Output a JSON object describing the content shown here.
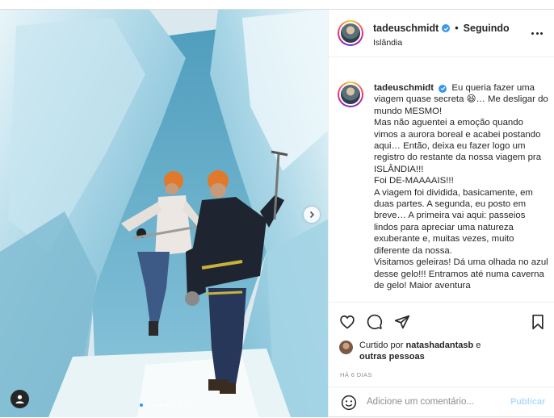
{
  "post": {
    "photo": {
      "alt_icon": "user-tag-icon",
      "next_icon": "chevron-right-icon",
      "carousel_total": 8,
      "carousel_active": 1
    },
    "header": {
      "username": "tadeuschmidt",
      "separator": "•",
      "follow_status": "Seguindo",
      "location": "Islândia",
      "more_icon": "more-options-icon"
    },
    "caption": {
      "username": "tadeuschmidt",
      "lines": [
        "Eu queria fazer uma viagem quase secreta 😆… Me desligar do mundo MESMO!",
        "Mas não aguentei a emoção quando vimos a aurora boreal e acabei postando aqui… Então, deixa eu fazer logo um registro do restante da nossa viagem pra ISLÂNDIA!!!",
        "Foi DE-MAAAAIS!!!",
        "A viagem foi dividida, basicamente, em duas partes. A segunda, eu posto em breve… A primeira vai aqui: passeios lindos para apreciar uma natureza exuberante e, muitas vezes, muito diferente da nossa.",
        "Visitamos geleiras! Dá uma olhada no azul desse gelo!!! Entramos até numa caverna de gelo! Maior aventura"
      ]
    },
    "actions": {
      "like_icon": "heart-icon",
      "comment_icon": "comment-icon",
      "share_icon": "share-icon",
      "save_icon": "bookmark-icon"
    },
    "likes": {
      "prefix": "Curtido por",
      "user": "natashadantasb",
      "conj": "e",
      "others": "outras pessoas"
    },
    "time_ago": "HÁ 6 DIAS",
    "comment": {
      "emoji_icon": "emoji-icon",
      "placeholder": "Adicione um comentário...",
      "publish_label": "Publicar"
    }
  }
}
